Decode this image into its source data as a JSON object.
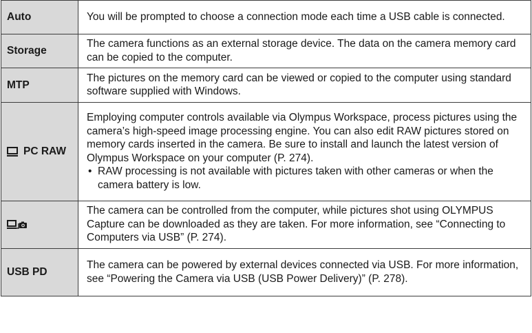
{
  "rows": [
    {
      "key_label": "Auto",
      "key_icon": null,
      "lines": [
        "You will be prompted to choose a connection mode each time a USB cable is connected."
      ],
      "bullet": null
    },
    {
      "key_label": "Storage",
      "key_icon": null,
      "lines": [
        "The camera functions as an external storage device. The data on the camera memory card can be copied to the computer."
      ],
      "bullet": null
    },
    {
      "key_label": "MTP",
      "key_icon": null,
      "lines": [
        "The pictures on the memory card can be viewed or copied to the computer using standard software supplied with Windows."
      ],
      "bullet": null
    },
    {
      "key_label": "PC RAW",
      "key_icon": "computer-monitor-icon",
      "lines": [
        "Employing computer controls available via Olympus Workspace, process pictures using the camera’s high-speed image processing engine. You can also edit RAW pictures stored on memory cards inserted in the camera. Be sure to install and launch the latest version of Olympus Workspace on your computer (P. 274)."
      ],
      "bullet": "RAW processing is not available with pictures taken with other cameras or when the camera battery is low."
    },
    {
      "key_label": "",
      "key_icon": "computer-camera-tethering-icon",
      "lines": [
        "The camera can be controlled from the computer, while pictures shot using OLYMPUS Capture can be downloaded as they are taken. For more information, see “Connecting to Computers via USB” (P. 274)."
      ],
      "bullet": null
    },
    {
      "key_label": "USB PD",
      "key_icon": null,
      "lines": [
        "The camera can be powered by external devices connected via USB. For more information, see “Powering the Camera via USB (USB Power Delivery)” (P. 278)."
      ],
      "bullet": null
    }
  ],
  "bullet_symbol": "•",
  "colors": {
    "key_cell_bg": "#d9d9d9",
    "border": "#3c3c3c",
    "text": "#1a1a1a"
  }
}
